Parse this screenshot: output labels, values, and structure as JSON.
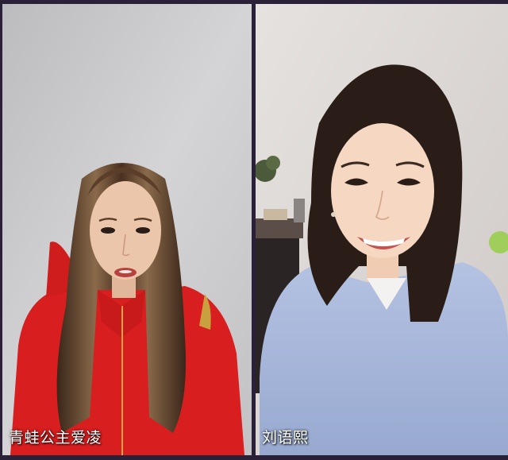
{
  "call": {
    "participants": [
      {
        "name": "青蛙公主爱凌"
      },
      {
        "name": "刘语熙"
      }
    ]
  },
  "colors": {
    "background": "#2a2138",
    "label_text": "#ffffff",
    "left_wall": "#c9c9cb",
    "right_wall": "#dedad8",
    "red_jacket": "#d81e1f",
    "blue_sweater": "#a9b9dc",
    "hair_dark": "#2a1d17"
  }
}
